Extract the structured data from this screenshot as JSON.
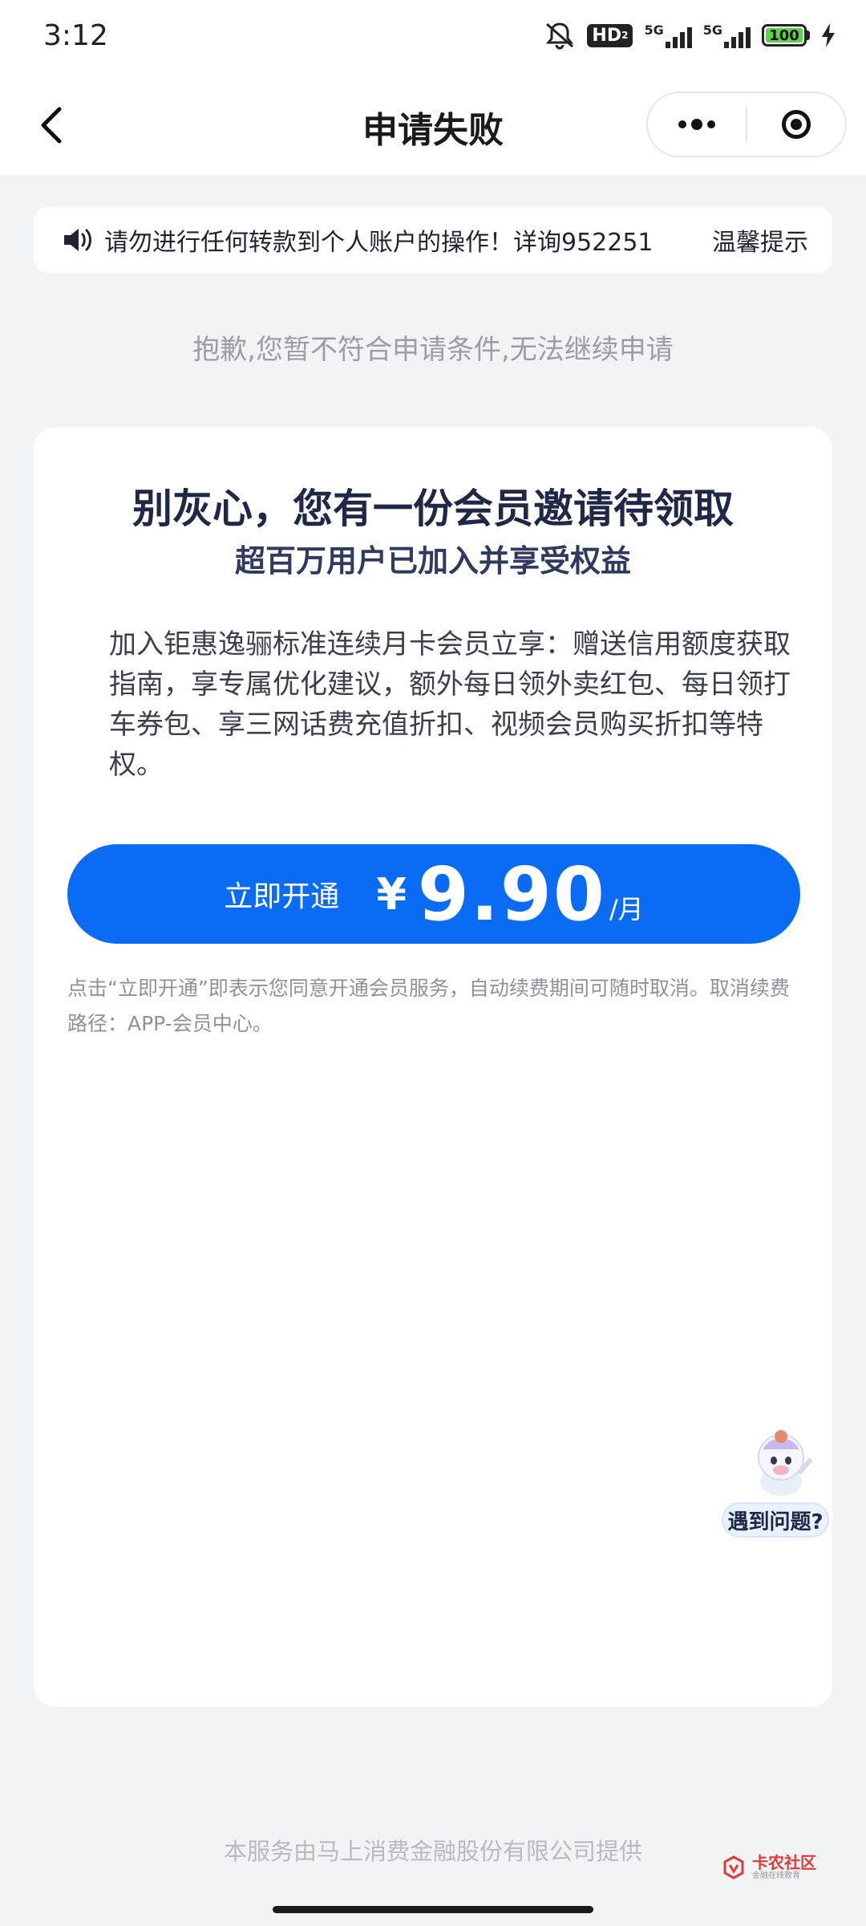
{
  "status_bar": {
    "time": "3:12",
    "hd_label": "HD",
    "hd_sub": "2",
    "signal_1_label": "5G",
    "signal_2_label": "5G",
    "battery_level": "100"
  },
  "navbar": {
    "title": "申请失败"
  },
  "notice": {
    "text": "请勿进行任何转款到个人账户的操作！详询952251",
    "tip_label": "温馨提示"
  },
  "reject_message": "抱歉,您暂不符合申请条件,无法继续申请",
  "card": {
    "title": "别灰心，您有一份会员邀请待领取",
    "subtitle": "超百万用户已加入并享受权益",
    "description": "加入钜惠逸骊标准连续月卡会员立享：赠送信用额度获取指南，享专属优化建议，额外每日领外卖红包、每日领打车券包、享三网话费充值折扣、视频会员购买折扣等特权。",
    "cta": {
      "label": "立即开通",
      "currency": "¥",
      "price": "9.90",
      "unit": "/月"
    },
    "agreement": "点击“立即开通”即表示您同意开通会员服务，自动续费期间可随时取消。取消续费路径：APP-会员中心。"
  },
  "helper": {
    "label": "遇到问题?"
  },
  "footer": {
    "provider_text": "本服务由马上消费金融股份有限公司提供",
    "watermark_brand": "卡农社区",
    "watermark_sub": "金融在线教育"
  },
  "colors": {
    "primary": "#0A6CF5",
    "background": "#F2F3F5",
    "battery": "#5BD34A"
  }
}
